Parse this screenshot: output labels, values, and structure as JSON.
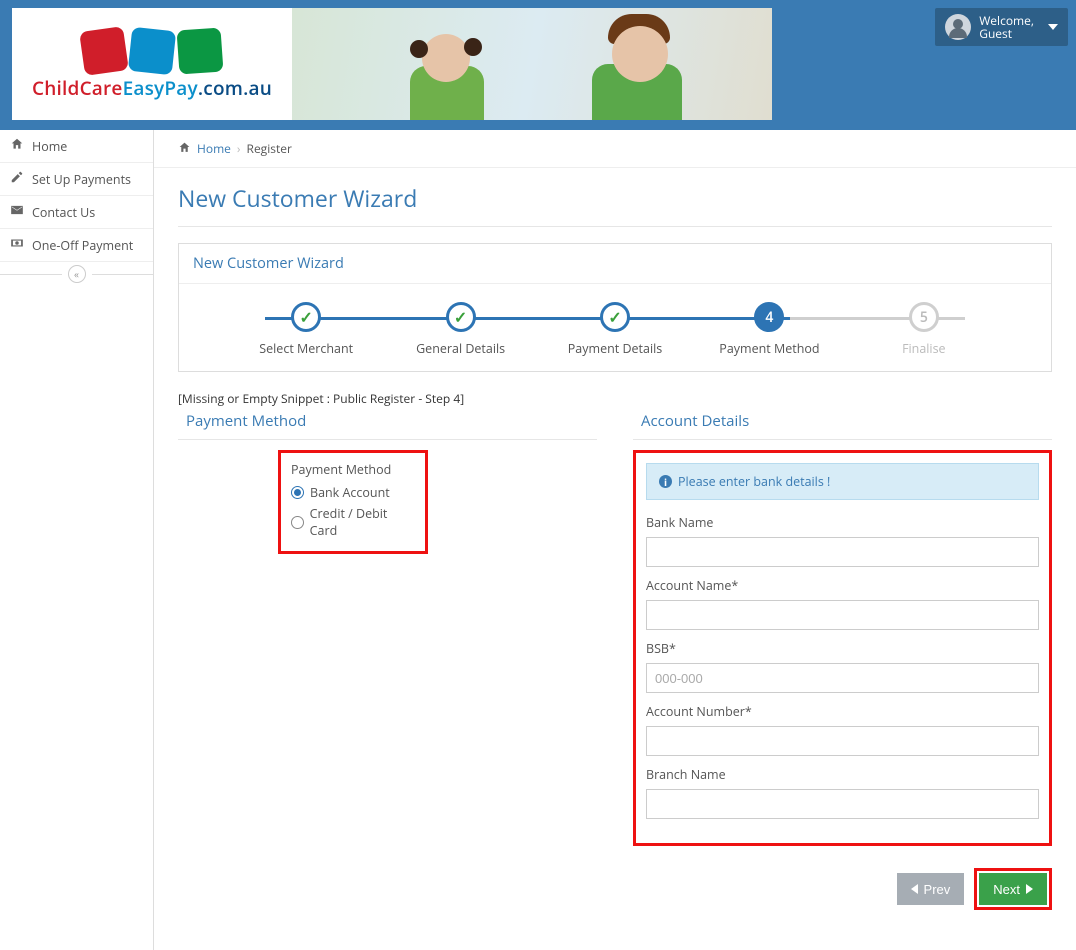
{
  "header": {
    "brand_parts": {
      "child": "Child",
      "care": "Care",
      "easy": "Easy",
      "pay": "Pay",
      "domain": ".com.au"
    },
    "user_menu": {
      "welcome": "Welcome,",
      "name": "Guest"
    }
  },
  "sidebar": {
    "items": [
      {
        "label": "Home",
        "icon": "home-icon"
      },
      {
        "label": "Set Up Payments",
        "icon": "edit-icon"
      },
      {
        "label": "Contact Us",
        "icon": "mail-icon"
      },
      {
        "label": "One-Off Payment",
        "icon": "cash-icon"
      }
    ]
  },
  "breadcrumb": {
    "home": "Home",
    "current": "Register"
  },
  "page": {
    "title": "New Customer Wizard"
  },
  "wizard": {
    "title": "New Customer Wizard",
    "steps": [
      {
        "label": "Select Merchant",
        "state": "done"
      },
      {
        "label": "General Details",
        "state": "done"
      },
      {
        "label": "Payment Details",
        "state": "done"
      },
      {
        "label": "Payment Method",
        "state": "current",
        "num": "4"
      },
      {
        "label": "Finalise",
        "state": "future",
        "num": "5"
      }
    ]
  },
  "snippet_msg": "[Missing or Empty Snippet : Public Register - Step 4]",
  "payment_method": {
    "section": "Payment Method",
    "group_label": "Payment Method",
    "options": {
      "bank": "Bank Account",
      "card": "Credit / Debit Card"
    },
    "selected": "bank"
  },
  "account_details": {
    "section": "Account Details",
    "alert": "Please enter bank details !",
    "fields": {
      "bank_name": {
        "label": "Bank Name",
        "value": "",
        "placeholder": ""
      },
      "account_name": {
        "label": "Account Name*",
        "value": "",
        "placeholder": ""
      },
      "bsb": {
        "label": "BSB*",
        "value": "",
        "placeholder": "000-000"
      },
      "account_number": {
        "label": "Account Number*",
        "value": "",
        "placeholder": ""
      },
      "branch_name": {
        "label": "Branch Name",
        "value": "",
        "placeholder": ""
      }
    }
  },
  "footer": {
    "prev": "Prev",
    "next": "Next"
  }
}
